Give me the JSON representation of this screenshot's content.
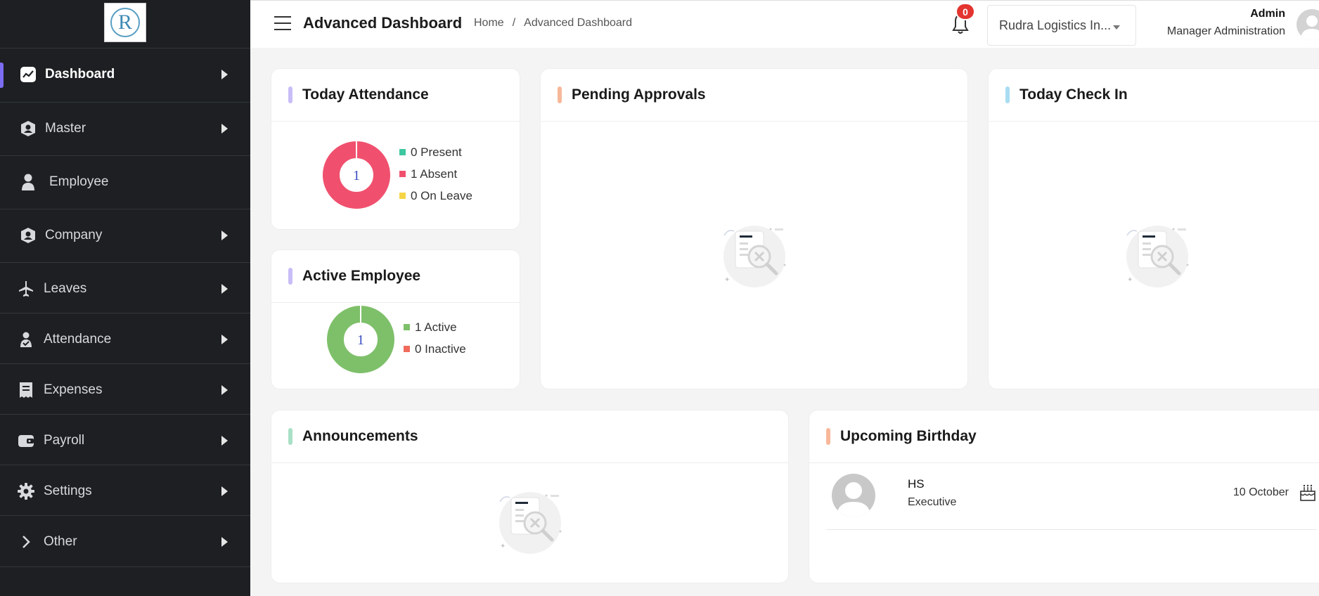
{
  "sidebar": {
    "logo_letter": "R",
    "items": [
      {
        "label": "Dashboard",
        "icon": "chart-line-icon",
        "active": true,
        "arrow": true
      },
      {
        "label": "Master",
        "icon": "user-shield-icon",
        "active": false,
        "arrow": true
      },
      {
        "label": "Employee",
        "icon": "person-icon",
        "active": false,
        "arrow": false
      },
      {
        "label": "Company",
        "icon": "user-shield-icon",
        "active": false,
        "arrow": true
      },
      {
        "label": "Leaves",
        "icon": "plane-icon",
        "active": false,
        "arrow": true
      },
      {
        "label": "Attendance",
        "icon": "user-check-icon",
        "active": false,
        "arrow": true
      },
      {
        "label": "Expenses",
        "icon": "receipt-icon",
        "active": false,
        "arrow": true
      },
      {
        "label": "Payroll",
        "icon": "wallet-icon",
        "active": false,
        "arrow": true
      },
      {
        "label": "Settings",
        "icon": "gear-icon",
        "active": false,
        "arrow": true
      },
      {
        "label": "Other",
        "icon": "chevron-right-icon",
        "active": false,
        "arrow": true
      }
    ]
  },
  "header": {
    "title": "Advanced Dashboard",
    "breadcrumb": [
      "Home",
      "/",
      "Advanced Dashboard"
    ],
    "notification_count": "0",
    "company": "Rudra Logistics In...",
    "user_name": "Admin",
    "user_role": "Manager Administration"
  },
  "cards": {
    "today_attendance": {
      "title": "Today Attendance",
      "center": "1",
      "legend": [
        "0 Present",
        "1 Absent",
        "0 On Leave"
      ],
      "colors": [
        "#3ec7a0",
        "#f0506e",
        "#f5d547"
      ]
    },
    "active_employee": {
      "title": "Active Employee",
      "center": "1",
      "legend": [
        "1 Active",
        "0 Inactive"
      ],
      "colors": [
        "#7ec06a",
        "#f06b5c"
      ]
    },
    "pending_approvals": {
      "title": "Pending Approvals"
    },
    "today_check_in": {
      "title": "Today Check In"
    },
    "announcements": {
      "title": "Announcements"
    },
    "upcoming_birthday": {
      "title": "Upcoming Birthday",
      "entries": [
        {
          "name": "HS",
          "role": "Executive",
          "date": "10 October"
        }
      ]
    }
  },
  "colors": {
    "attendance_bar": "#c9bdf7",
    "active_bar": "#c9bdf7",
    "pending_bar": "#f7b89a",
    "checkin_bar": "#a8ddf2",
    "announce_bar": "#a9e0c6",
    "birthday_bar": "#f7b89a"
  }
}
